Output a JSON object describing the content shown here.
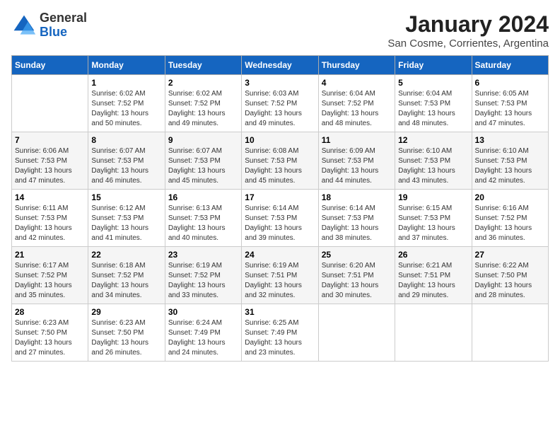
{
  "logo": {
    "line1": "General",
    "line2": "Blue"
  },
  "title": "January 2024",
  "subtitle": "San Cosme, Corrientes, Argentina",
  "days_of_week": [
    "Sunday",
    "Monday",
    "Tuesday",
    "Wednesday",
    "Thursday",
    "Friday",
    "Saturday"
  ],
  "weeks": [
    [
      {
        "num": "",
        "sunrise": "",
        "sunset": "",
        "daylight": ""
      },
      {
        "num": "1",
        "sunrise": "Sunrise: 6:02 AM",
        "sunset": "Sunset: 7:52 PM",
        "daylight": "Daylight: 13 hours and 50 minutes."
      },
      {
        "num": "2",
        "sunrise": "Sunrise: 6:02 AM",
        "sunset": "Sunset: 7:52 PM",
        "daylight": "Daylight: 13 hours and 49 minutes."
      },
      {
        "num": "3",
        "sunrise": "Sunrise: 6:03 AM",
        "sunset": "Sunset: 7:52 PM",
        "daylight": "Daylight: 13 hours and 49 minutes."
      },
      {
        "num": "4",
        "sunrise": "Sunrise: 6:04 AM",
        "sunset": "Sunset: 7:52 PM",
        "daylight": "Daylight: 13 hours and 48 minutes."
      },
      {
        "num": "5",
        "sunrise": "Sunrise: 6:04 AM",
        "sunset": "Sunset: 7:53 PM",
        "daylight": "Daylight: 13 hours and 48 minutes."
      },
      {
        "num": "6",
        "sunrise": "Sunrise: 6:05 AM",
        "sunset": "Sunset: 7:53 PM",
        "daylight": "Daylight: 13 hours and 47 minutes."
      }
    ],
    [
      {
        "num": "7",
        "sunrise": "Sunrise: 6:06 AM",
        "sunset": "Sunset: 7:53 PM",
        "daylight": "Daylight: 13 hours and 47 minutes."
      },
      {
        "num": "8",
        "sunrise": "Sunrise: 6:07 AM",
        "sunset": "Sunset: 7:53 PM",
        "daylight": "Daylight: 13 hours and 46 minutes."
      },
      {
        "num": "9",
        "sunrise": "Sunrise: 6:07 AM",
        "sunset": "Sunset: 7:53 PM",
        "daylight": "Daylight: 13 hours and 45 minutes."
      },
      {
        "num": "10",
        "sunrise": "Sunrise: 6:08 AM",
        "sunset": "Sunset: 7:53 PM",
        "daylight": "Daylight: 13 hours and 45 minutes."
      },
      {
        "num": "11",
        "sunrise": "Sunrise: 6:09 AM",
        "sunset": "Sunset: 7:53 PM",
        "daylight": "Daylight: 13 hours and 44 minutes."
      },
      {
        "num": "12",
        "sunrise": "Sunrise: 6:10 AM",
        "sunset": "Sunset: 7:53 PM",
        "daylight": "Daylight: 13 hours and 43 minutes."
      },
      {
        "num": "13",
        "sunrise": "Sunrise: 6:10 AM",
        "sunset": "Sunset: 7:53 PM",
        "daylight": "Daylight: 13 hours and 42 minutes."
      }
    ],
    [
      {
        "num": "14",
        "sunrise": "Sunrise: 6:11 AM",
        "sunset": "Sunset: 7:53 PM",
        "daylight": "Daylight: 13 hours and 42 minutes."
      },
      {
        "num": "15",
        "sunrise": "Sunrise: 6:12 AM",
        "sunset": "Sunset: 7:53 PM",
        "daylight": "Daylight: 13 hours and 41 minutes."
      },
      {
        "num": "16",
        "sunrise": "Sunrise: 6:13 AM",
        "sunset": "Sunset: 7:53 PM",
        "daylight": "Daylight: 13 hours and 40 minutes."
      },
      {
        "num": "17",
        "sunrise": "Sunrise: 6:14 AM",
        "sunset": "Sunset: 7:53 PM",
        "daylight": "Daylight: 13 hours and 39 minutes."
      },
      {
        "num": "18",
        "sunrise": "Sunrise: 6:14 AM",
        "sunset": "Sunset: 7:53 PM",
        "daylight": "Daylight: 13 hours and 38 minutes."
      },
      {
        "num": "19",
        "sunrise": "Sunrise: 6:15 AM",
        "sunset": "Sunset: 7:53 PM",
        "daylight": "Daylight: 13 hours and 37 minutes."
      },
      {
        "num": "20",
        "sunrise": "Sunrise: 6:16 AM",
        "sunset": "Sunset: 7:52 PM",
        "daylight": "Daylight: 13 hours and 36 minutes."
      }
    ],
    [
      {
        "num": "21",
        "sunrise": "Sunrise: 6:17 AM",
        "sunset": "Sunset: 7:52 PM",
        "daylight": "Daylight: 13 hours and 35 minutes."
      },
      {
        "num": "22",
        "sunrise": "Sunrise: 6:18 AM",
        "sunset": "Sunset: 7:52 PM",
        "daylight": "Daylight: 13 hours and 34 minutes."
      },
      {
        "num": "23",
        "sunrise": "Sunrise: 6:19 AM",
        "sunset": "Sunset: 7:52 PM",
        "daylight": "Daylight: 13 hours and 33 minutes."
      },
      {
        "num": "24",
        "sunrise": "Sunrise: 6:19 AM",
        "sunset": "Sunset: 7:51 PM",
        "daylight": "Daylight: 13 hours and 32 minutes."
      },
      {
        "num": "25",
        "sunrise": "Sunrise: 6:20 AM",
        "sunset": "Sunset: 7:51 PM",
        "daylight": "Daylight: 13 hours and 30 minutes."
      },
      {
        "num": "26",
        "sunrise": "Sunrise: 6:21 AM",
        "sunset": "Sunset: 7:51 PM",
        "daylight": "Daylight: 13 hours and 29 minutes."
      },
      {
        "num": "27",
        "sunrise": "Sunrise: 6:22 AM",
        "sunset": "Sunset: 7:50 PM",
        "daylight": "Daylight: 13 hours and 28 minutes."
      }
    ],
    [
      {
        "num": "28",
        "sunrise": "Sunrise: 6:23 AM",
        "sunset": "Sunset: 7:50 PM",
        "daylight": "Daylight: 13 hours and 27 minutes."
      },
      {
        "num": "29",
        "sunrise": "Sunrise: 6:23 AM",
        "sunset": "Sunset: 7:50 PM",
        "daylight": "Daylight: 13 hours and 26 minutes."
      },
      {
        "num": "30",
        "sunrise": "Sunrise: 6:24 AM",
        "sunset": "Sunset: 7:49 PM",
        "daylight": "Daylight: 13 hours and 24 minutes."
      },
      {
        "num": "31",
        "sunrise": "Sunrise: 6:25 AM",
        "sunset": "Sunset: 7:49 PM",
        "daylight": "Daylight: 13 hours and 23 minutes."
      },
      {
        "num": "",
        "sunrise": "",
        "sunset": "",
        "daylight": ""
      },
      {
        "num": "",
        "sunrise": "",
        "sunset": "",
        "daylight": ""
      },
      {
        "num": "",
        "sunrise": "",
        "sunset": "",
        "daylight": ""
      }
    ]
  ]
}
